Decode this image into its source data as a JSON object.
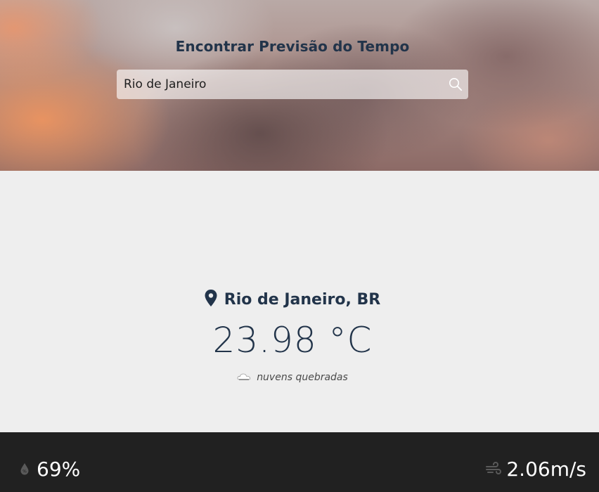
{
  "header": {
    "title": "Encontrar Previsão do Tempo",
    "search": {
      "value": "Rio de Janeiro",
      "placeholder": ""
    }
  },
  "weather": {
    "location": "Rio de Janeiro, BR",
    "temperature": "23.98 °C",
    "condition": "nuvens quebradas"
  },
  "stats": {
    "humidity": "69%",
    "wind": "2.06m/s"
  },
  "icons": {
    "search": "search-icon",
    "location": "map-pin-icon",
    "condition": "broken-clouds-icon",
    "humidity": "water-drop-icon",
    "wind": "wind-icon"
  },
  "colors": {
    "title": "#22344a",
    "footer_background": "#212121",
    "main_background": "#eeeeee"
  }
}
